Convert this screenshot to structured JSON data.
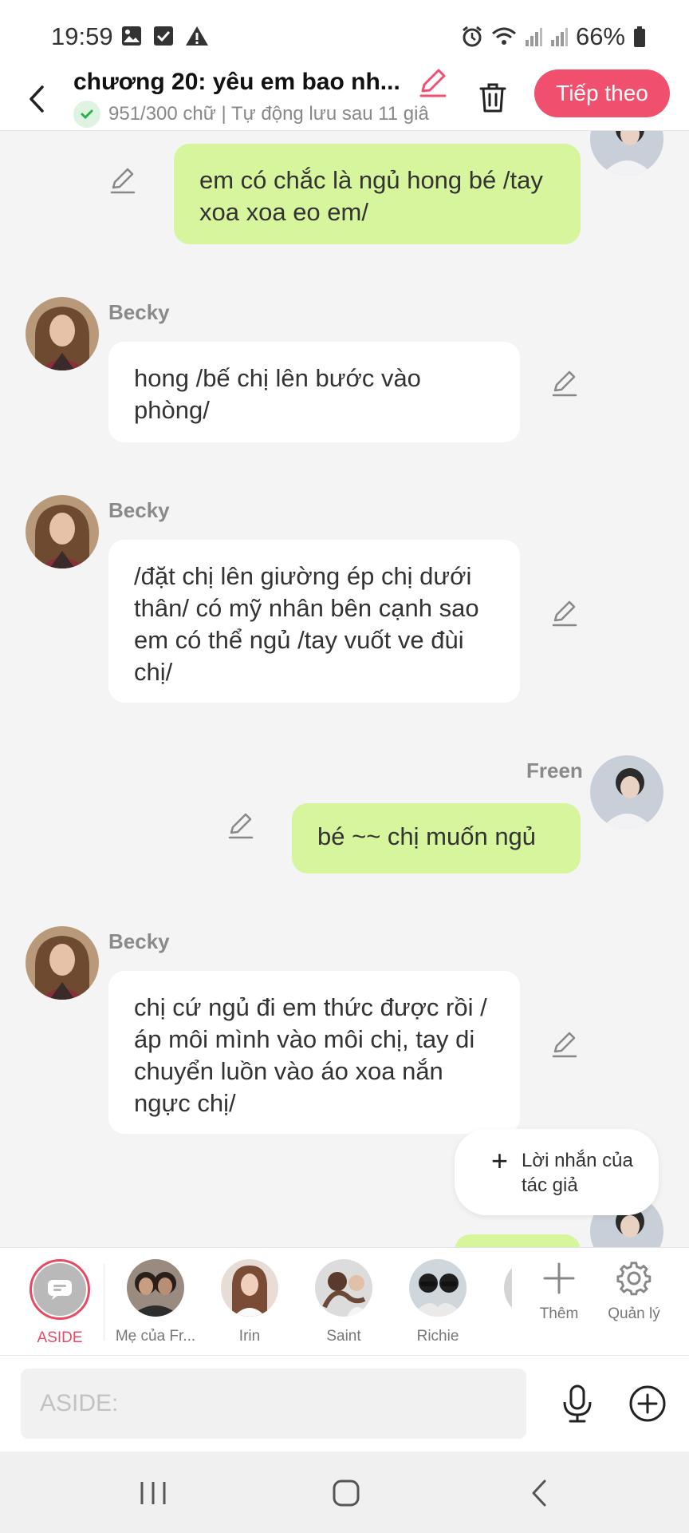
{
  "status_bar": {
    "time": "19:59",
    "battery": "66%",
    "icons_left": [
      "image-icon",
      "checkbox-icon",
      "warning-icon"
    ],
    "icons_right": [
      "alarm-icon",
      "wifi-icon",
      "signal-icon",
      "signal-icon",
      "battery-icon"
    ]
  },
  "header": {
    "title": "chương 20: yêu em bao nh...",
    "save_status": "951/300 chữ | Tự động lưu sau 11 giâ",
    "next_label": "Tiếp theo"
  },
  "messages": [
    {
      "side": "right",
      "sender": "",
      "text": "em có chắc là ngủ hong bé /tay xoa xoa eo em/"
    },
    {
      "side": "left",
      "sender": "Becky",
      "text": "hong /bế chị lên bước vào phòng/"
    },
    {
      "side": "left",
      "sender": "Becky",
      "text": "/đặt chị lên giường ép chị dưới thân/ có mỹ nhân bên cạnh sao em có thể ngủ /tay vuốt ve đùi chị/"
    },
    {
      "side": "right",
      "sender": "Freen",
      "text": "bé ~~ chị muốn ngủ"
    },
    {
      "side": "left",
      "sender": "Becky",
      "text": "chị cứ ngủ đi em thức được rồi /áp môi mình vào môi chị, tay di chuyển luồn vào áo xoa nắn ngực chị/"
    }
  ],
  "author_note": {
    "label": "Lời nhắn của tác giả"
  },
  "characters": [
    {
      "name": "ASIDE",
      "active": true
    },
    {
      "name": "Mẹ của Fr..."
    },
    {
      "name": "Irin"
    },
    {
      "name": "Saint"
    },
    {
      "name": "Richie"
    }
  ],
  "tools": {
    "add_label": "Thêm",
    "manage_label": "Quản lý"
  },
  "input": {
    "placeholder": "ASIDE:"
  },
  "colors": {
    "accent": "#f0506e",
    "right_bubble": "#d7f59c",
    "left_bubble": "#ffffff",
    "background": "#f4f4f4"
  }
}
